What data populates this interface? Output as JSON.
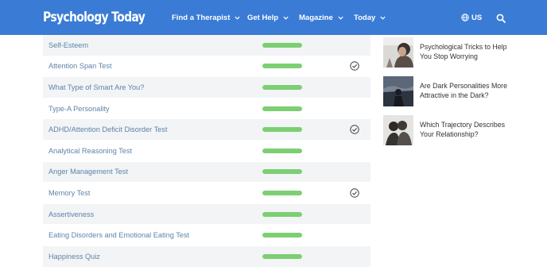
{
  "header": {
    "logo": "Psychology Today",
    "nav": [
      {
        "label": "Find a Therapist"
      },
      {
        "label": "Get Help"
      },
      {
        "label": "Magazine"
      },
      {
        "label": "Today"
      }
    ],
    "region": "US",
    "icons": {
      "region": "globe-icon",
      "search": "search-icon",
      "dropdown": "chevron-down-icon"
    },
    "color": "#3a7bd5"
  },
  "tests": [
    {
      "label": "Self-Esteem",
      "progress": 1.0,
      "completed": false
    },
    {
      "label": "Attention Span Test",
      "progress": 1.0,
      "completed": true
    },
    {
      "label": "What Type of Smart Are You?",
      "progress": 1.0,
      "completed": false
    },
    {
      "label": "Type-A Personality",
      "progress": 1.0,
      "completed": false
    },
    {
      "label": "ADHD/Attention Deficit Disorder Test",
      "progress": 1.0,
      "completed": true
    },
    {
      "label": "Analytical Reasoning Test",
      "progress": 1.0,
      "completed": false
    },
    {
      "label": "Anger Management Test",
      "progress": 1.0,
      "completed": false
    },
    {
      "label": "Memory Test",
      "progress": 1.0,
      "completed": true
    },
    {
      "label": "Assertiveness",
      "progress": 1.0,
      "completed": false
    },
    {
      "label": "Eating Disorders and Emotional Eating Test",
      "progress": 1.0,
      "completed": false
    },
    {
      "label": "Happiness Quiz",
      "progress": 1.0,
      "completed": false
    }
  ],
  "colors": {
    "progress": "#7ccf72",
    "link": "#5e84a8",
    "row_shade": "#f2f4f6"
  },
  "articles": [
    {
      "title": "Psychological Tricks to Help You Stop Worrying"
    },
    {
      "title": "Are Dark Personalities More Attractive in the Dark?"
    },
    {
      "title": "Which Trajectory Describes Your Relationship?"
    }
  ]
}
